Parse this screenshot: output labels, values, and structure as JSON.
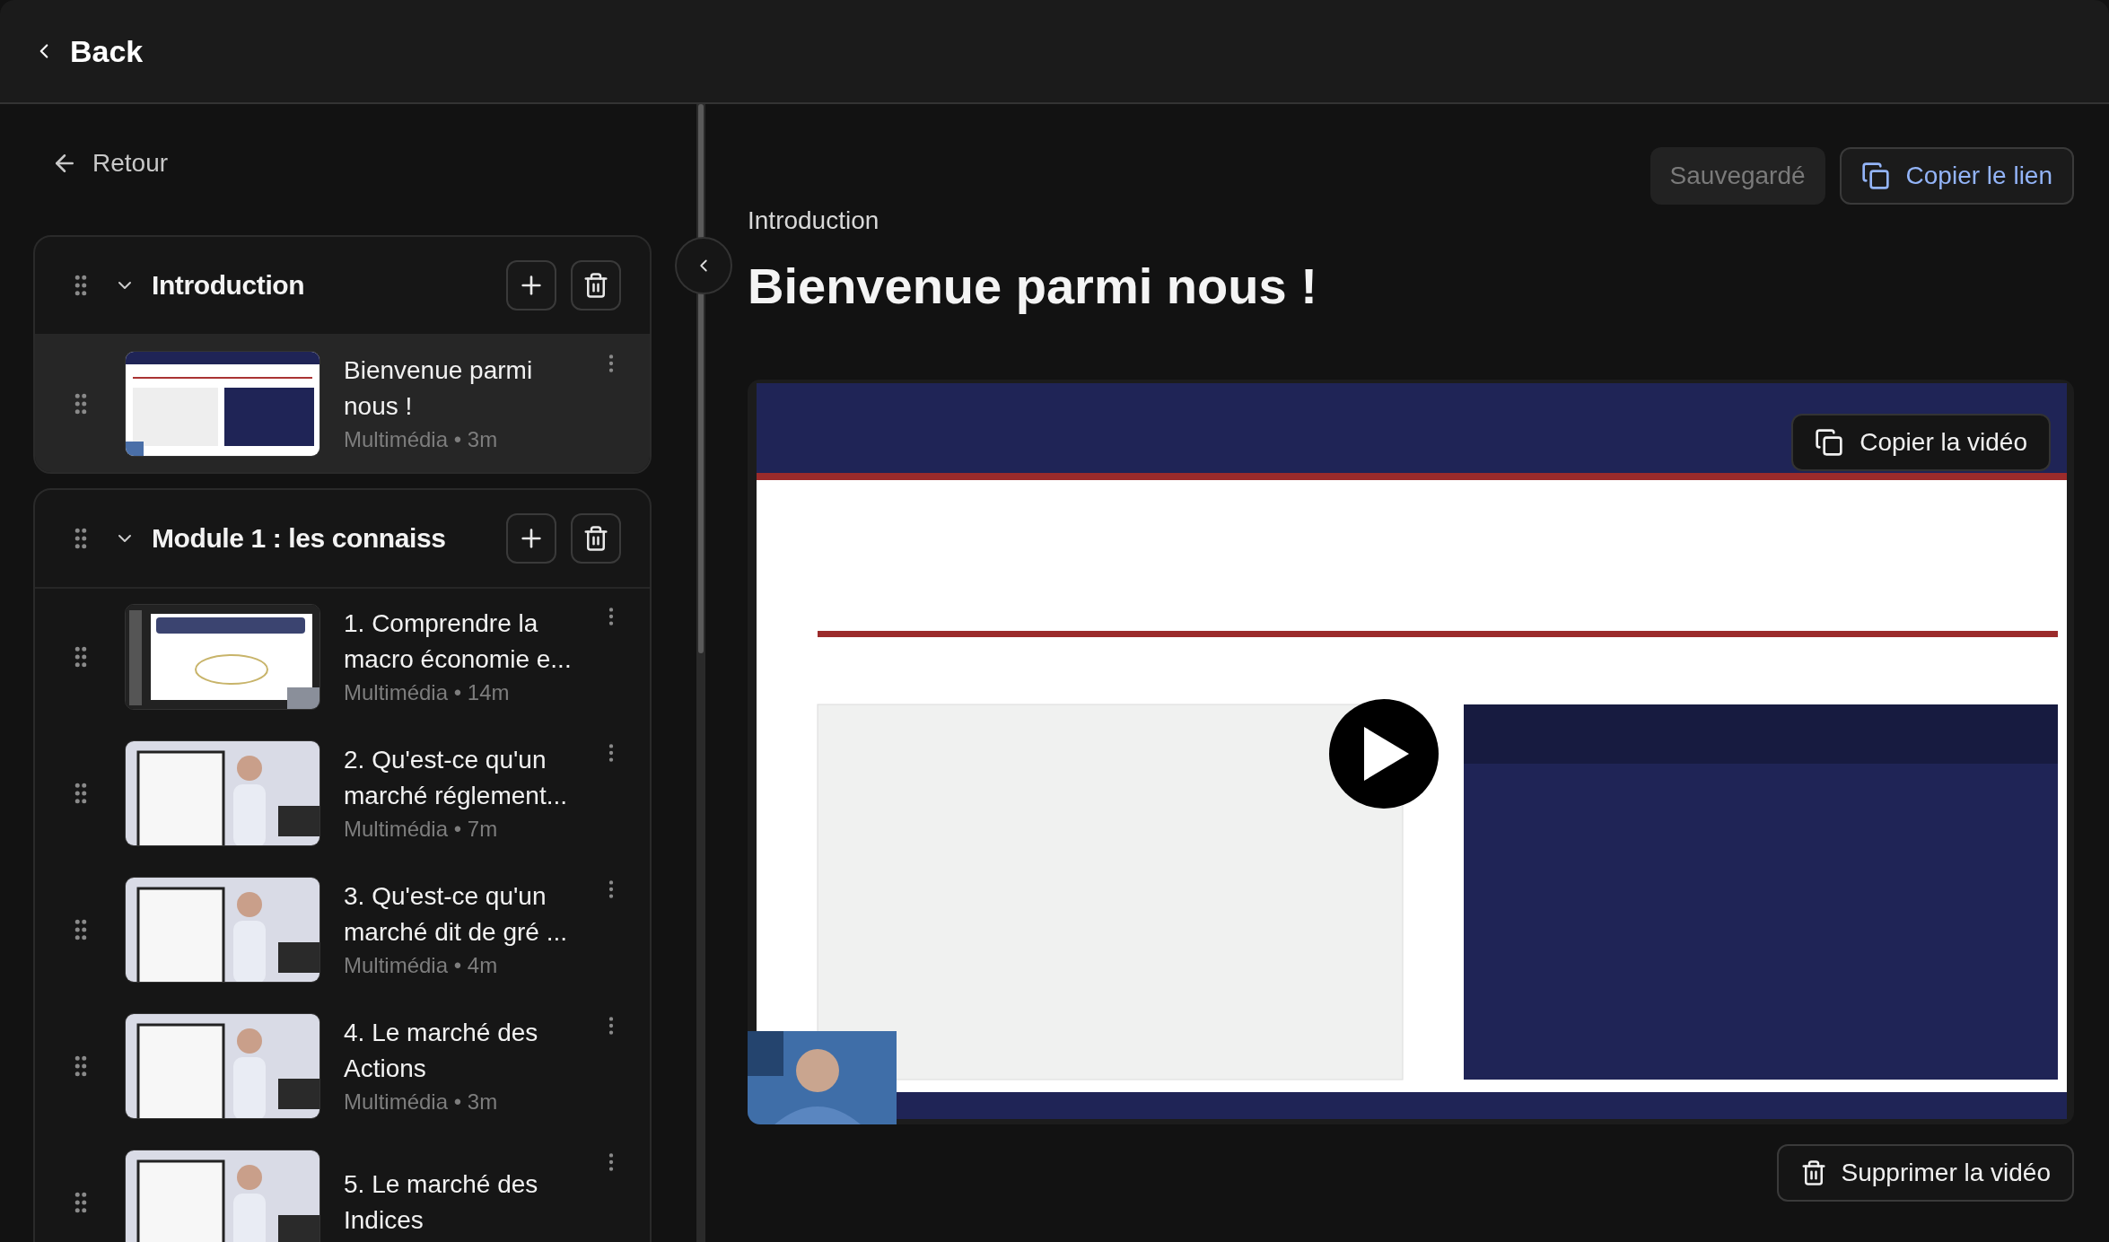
{
  "header": {
    "back_label": "Back"
  },
  "sidebar": {
    "back_link": "Retour",
    "sections": [
      {
        "title": "Introduction",
        "expanded": true,
        "lessons": [
          {
            "title": "Bienvenue parmi nous !",
            "meta": "Multimédia • 3m",
            "selected": true
          }
        ]
      },
      {
        "title": "Module 1 : les connaiss",
        "expanded": true,
        "lessons": [
          {
            "title": "1. Comprendre la macro économie e...",
            "meta": "Multimédia • 14m",
            "selected": false
          },
          {
            "title": "2. Qu'est-ce qu'un marché réglement...",
            "meta": "Multimédia • 7m",
            "selected": false
          },
          {
            "title": "3. Qu'est-ce qu'un marché dit de gré ...",
            "meta": "Multimédia • 4m",
            "selected": false
          },
          {
            "title": "4. Le marché des Actions",
            "meta": "Multimédia • 3m",
            "selected": false
          },
          {
            "title": "5. Le marché des Indices",
            "selected": false
          }
        ]
      }
    ]
  },
  "main": {
    "breadcrumb": "Introduction",
    "title": "Bienvenue parmi nous !",
    "save_button": {
      "label": "Sauvegardé",
      "disabled": true
    },
    "copy_link_label": "Copier le lien",
    "video": {
      "copy_label": "Copier la vidéo"
    },
    "delete_label": "Supprimer la vidéo"
  }
}
